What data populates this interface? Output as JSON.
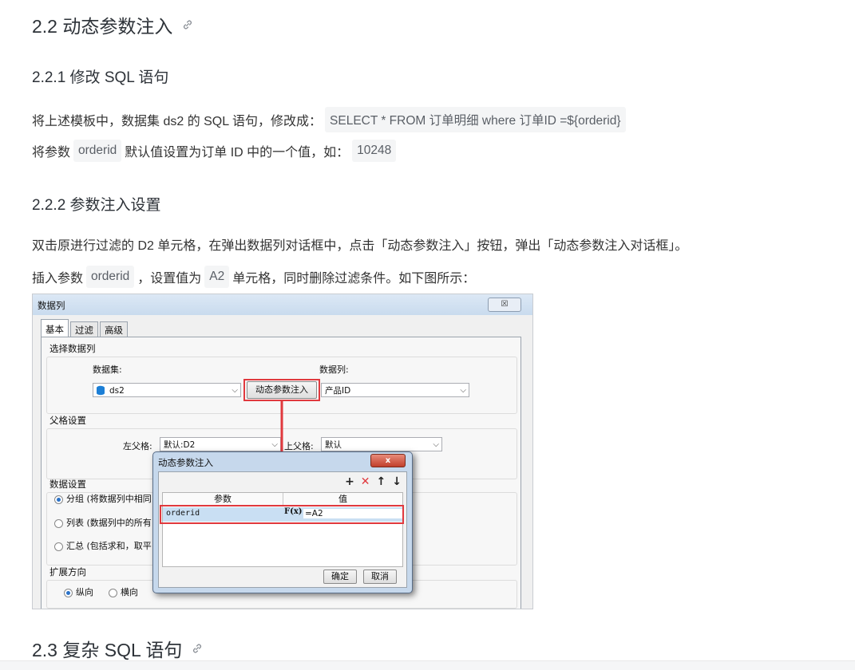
{
  "sec_2_2": {
    "title": "2.2 动态参数注入"
  },
  "sec_2_2_1": {
    "title": "2.2.1 修改 SQL 语句",
    "line1_pre": "将上述模板中，数据集 ds2 的 SQL 语句，修改成：",
    "line1_code": "SELECT * FROM 订单明细 where 订单ID =${orderid}",
    "line2_pre": "将参数",
    "line2_code1": "orderid",
    "line2_mid": "默认值设置为订单 ID 中的一个值，如：",
    "line2_code2": "10248"
  },
  "sec_2_2_2": {
    "title": "2.2.2 参数注入设置",
    "line1": "双击原进行过滤的 D2 单元格，在弹出数据列对话框中，点击「动态参数注入」按钮，弹出「动态参数注入对话框」。",
    "line2_pre": "插入参数",
    "line2_code1": "orderid",
    "line2_mid": "，设置值为",
    "line2_code2": "A2",
    "line2_post": "单元格，同时删除过滤条件。如下图所示："
  },
  "sec_2_3": {
    "title": "2.3 复杂 SQL 语句"
  },
  "dialog": {
    "title": "数据列",
    "close": "☒",
    "tabs": [
      "基本",
      "过滤",
      "高级"
    ],
    "select_col_group": "选择数据列",
    "dataset_label": "数据集:",
    "dataset_value": "ds2",
    "dyn_btn": "动态参数注入",
    "col_label": "数据列:",
    "col_value": "产品ID",
    "parent_group": "父格设置",
    "left_parent_label": "左父格:",
    "left_parent_value": "默认:D2",
    "up_parent_label": "上父格:",
    "up_parent_value": "默认",
    "data_group": "数据设置",
    "radio1": "分组 (将数据列中相同",
    "radio2": "列表 (数据列中的所有",
    "radio3": "汇总 (包括求和，取平",
    "expand_group": "扩展方向",
    "expand_v": "纵向",
    "expand_h": "横向"
  },
  "inner_dialog": {
    "title": "动态参数注入",
    "close": "x",
    "col_param": "参数",
    "col_value": "值",
    "row_param": "orderid",
    "row_formula": "F(x)",
    "row_value": "=A2",
    "ok": "确定",
    "cancel": "取消",
    "accent_red": "#e0393e"
  }
}
